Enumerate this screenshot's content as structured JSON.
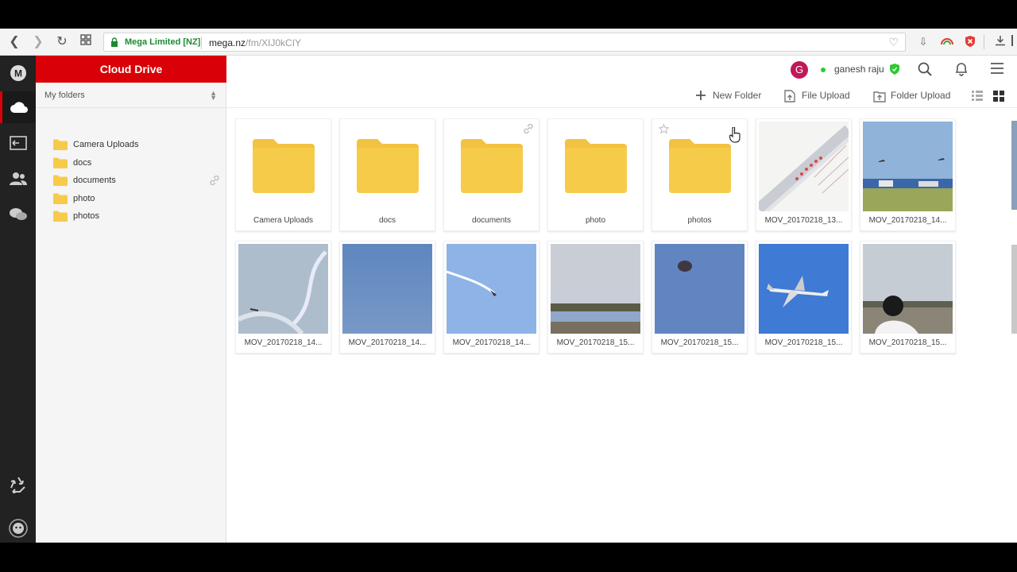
{
  "browser": {
    "secure_label": "Mega Limited [NZ]",
    "url_host": "mega.nz",
    "url_path": "/fm/XIJ0kCIY"
  },
  "sidebar": {
    "title": "Cloud Drive",
    "section_label": "My folders",
    "tree": [
      {
        "label": "Camera Uploads"
      },
      {
        "label": "docs"
      },
      {
        "label": "documents",
        "linked": true
      },
      {
        "label": "photo"
      },
      {
        "label": "photos"
      }
    ]
  },
  "header": {
    "avatar_letter": "G",
    "username": "ganesh raju"
  },
  "toolbar": {
    "new_folder": "New Folder",
    "file_upload": "File Upload",
    "folder_upload": "Folder Upload"
  },
  "items": [
    {
      "name": "Camera Uploads",
      "kind": "folder"
    },
    {
      "name": "docs",
      "kind": "folder"
    },
    {
      "name": "documents",
      "kind": "folder",
      "linked": true
    },
    {
      "name": "photo",
      "kind": "folder"
    },
    {
      "name": "photos",
      "kind": "folder",
      "starred": true
    },
    {
      "name": "MOV_20170218_13...",
      "kind": "video",
      "thumb": "runway"
    },
    {
      "name": "MOV_20170218_14...",
      "kind": "video",
      "thumb": "field"
    },
    {
      "name": "MOV_20170218_14...",
      "kind": "video",
      "thumb": "smoke"
    },
    {
      "name": "MOV_20170218_14...",
      "kind": "video",
      "thumb": "blue"
    },
    {
      "name": "MOV_20170218_14...",
      "kind": "video",
      "thumb": "jet-trail"
    },
    {
      "name": "MOV_20170218_15...",
      "kind": "video",
      "thumb": "horizon"
    },
    {
      "name": "MOV_20170218_15...",
      "kind": "video",
      "thumb": "dark-spot"
    },
    {
      "name": "MOV_20170218_15...",
      "kind": "video",
      "thumb": "airliner"
    },
    {
      "name": "MOV_20170218_15...",
      "kind": "video",
      "thumb": "crowd"
    }
  ],
  "colors": {
    "brand_red": "#d90007",
    "folder_yellow": "#f7cb4a",
    "rail_dark": "#222222"
  }
}
